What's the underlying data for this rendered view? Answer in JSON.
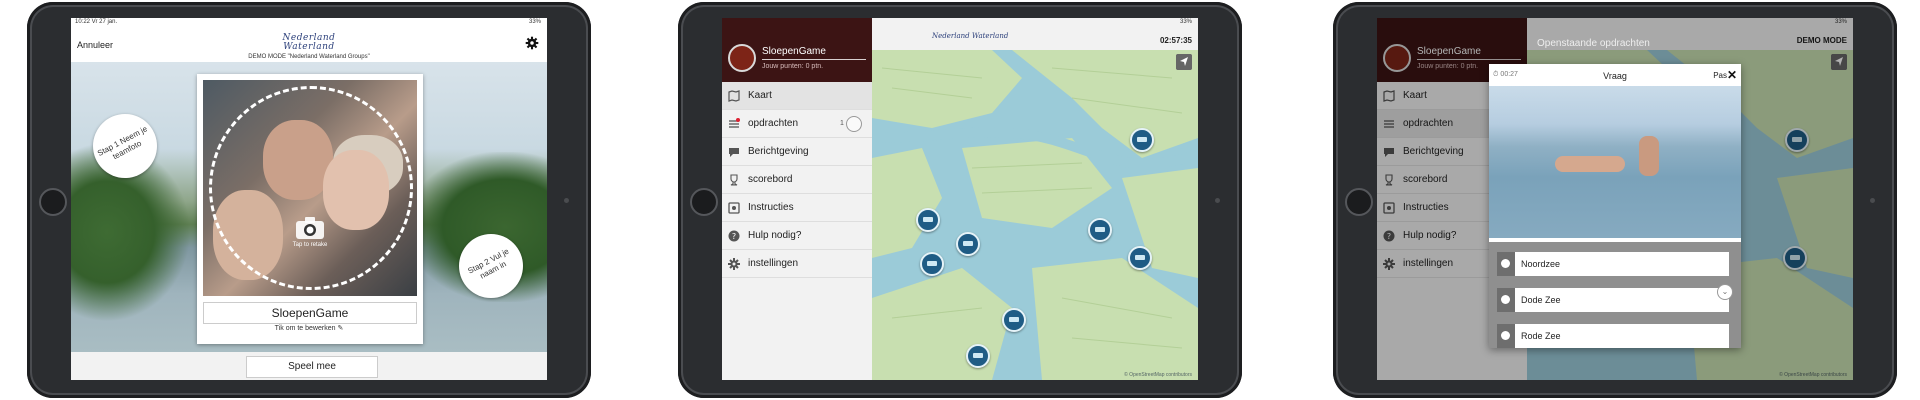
{
  "tablet1": {
    "status_time": "10:22  Vr 27 jan.",
    "status_right": "33%",
    "cancel_label": "Annuleer",
    "logo_line1": "Nederland",
    "logo_line2": "Waterland",
    "demo_mode": "DEMO MODE \"Nederland Waterland Groups\"",
    "step1": "Stap 1 Neem je teamfoto",
    "step2": "Stap 2 Vul je naam in",
    "tap_to_retake": "Tap to retake",
    "team_name": "SloepenGame",
    "edit_hint": "Tik om te bewerken",
    "play_button": "Speel mee"
  },
  "sidebar": {
    "team_name": "SloepenGame",
    "points": "Jouw punten: 0 ptn.",
    "items": [
      {
        "label": "Kaart",
        "icon": "map-icon"
      },
      {
        "label": "opdrachten",
        "icon": "list-icon",
        "badge": "1"
      },
      {
        "label": "Berichtgeving",
        "icon": "chat-icon"
      },
      {
        "label": "scorebord",
        "icon": "trophy-icon"
      },
      {
        "label": "Instructies",
        "icon": "info-icon"
      },
      {
        "label": "Hulp nodig?",
        "icon": "help-icon"
      },
      {
        "label": "instellingen",
        "icon": "gear-icon"
      }
    ]
  },
  "tablet2": {
    "status_right": "33%",
    "map_logo": "Nederland Waterland",
    "timer": "02:57:35",
    "attribution": "© OpenStreetMap contributors"
  },
  "tablet3": {
    "header_title": "Openstaande opdrachten",
    "demo_mode": "DEMO MODE",
    "status_right": "33%",
    "dialog": {
      "timer": "00:27",
      "title": "Vraag",
      "skip": "Pas",
      "close": "✕",
      "options": [
        "Noordzee",
        "Dode Zee",
        "Rode Zee"
      ]
    }
  },
  "colors": {
    "sidebar_header": "#3c1414",
    "map_water": "#9bcbd8",
    "map_land": "#c8dfb0",
    "pin": "#1f5c85"
  }
}
